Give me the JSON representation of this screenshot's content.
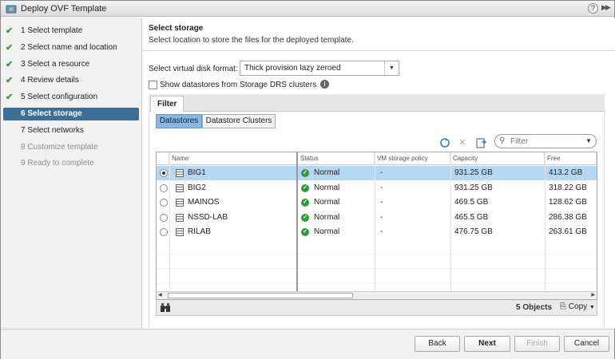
{
  "window": {
    "title": "Deploy OVF Template",
    "help_label": "?",
    "expand_label": "▶▶"
  },
  "steps": [
    {
      "label": "1  Select template",
      "done": true
    },
    {
      "label": "2  Select name and location",
      "done": true
    },
    {
      "label": "3  Select a resource",
      "done": true
    },
    {
      "label": "4  Review details",
      "done": true
    },
    {
      "label": "5  Select configuration",
      "done": true
    },
    {
      "label": "6  Select storage",
      "active": true
    },
    {
      "label": "7  Select networks"
    },
    {
      "label": "8  Customize template",
      "disabled": true
    },
    {
      "label": "9  Ready to complete",
      "disabled": true
    }
  ],
  "section": {
    "title": "Select storage",
    "description": "Select location to store the files for the deployed template."
  },
  "disk_format": {
    "label": "Select virtual disk format:",
    "value": "Thick provision lazy zeroed"
  },
  "drs": {
    "label": "Show datastores from Storage DRS clusters",
    "checked": false
  },
  "filter_tab": "Filter",
  "toggle": {
    "datastores": "Datastores",
    "clusters": "Datastore Clusters",
    "selected": "datastores"
  },
  "search": {
    "placeholder": "Filter"
  },
  "table": {
    "columns": [
      "Name",
      "Status",
      "VM storage policy",
      "Capacity",
      "Free"
    ],
    "rows": [
      {
        "name": "BIG1",
        "status": "Normal",
        "policy": "-",
        "capacity": "931.25  GB",
        "free": "413.2  GB",
        "selected": true
      },
      {
        "name": "BIG2",
        "status": "Normal",
        "policy": "-",
        "capacity": "931.25  GB",
        "free": "318.22  GB"
      },
      {
        "name": "MAINOS",
        "status": "Normal",
        "policy": "-",
        "capacity": "469.5  GB",
        "free": "128.62  GB"
      },
      {
        "name": "NSSD-LAB",
        "status": "Normal",
        "policy": "-",
        "capacity": "465.5  GB",
        "free": "286.38  GB"
      },
      {
        "name": "RILAB",
        "status": "Normal",
        "policy": "-",
        "capacity": "476.75  GB",
        "free": "263.61  GB"
      }
    ],
    "object_count": "5 Objects",
    "copy_label": "Copy"
  },
  "buttons": {
    "back": "Back",
    "next": "Next",
    "finish": "Finish",
    "cancel": "Cancel"
  },
  "colors": {
    "accent": "#3d6e95",
    "selected_row": "#b6d7f2",
    "status_ok": "#2e9c3a"
  }
}
